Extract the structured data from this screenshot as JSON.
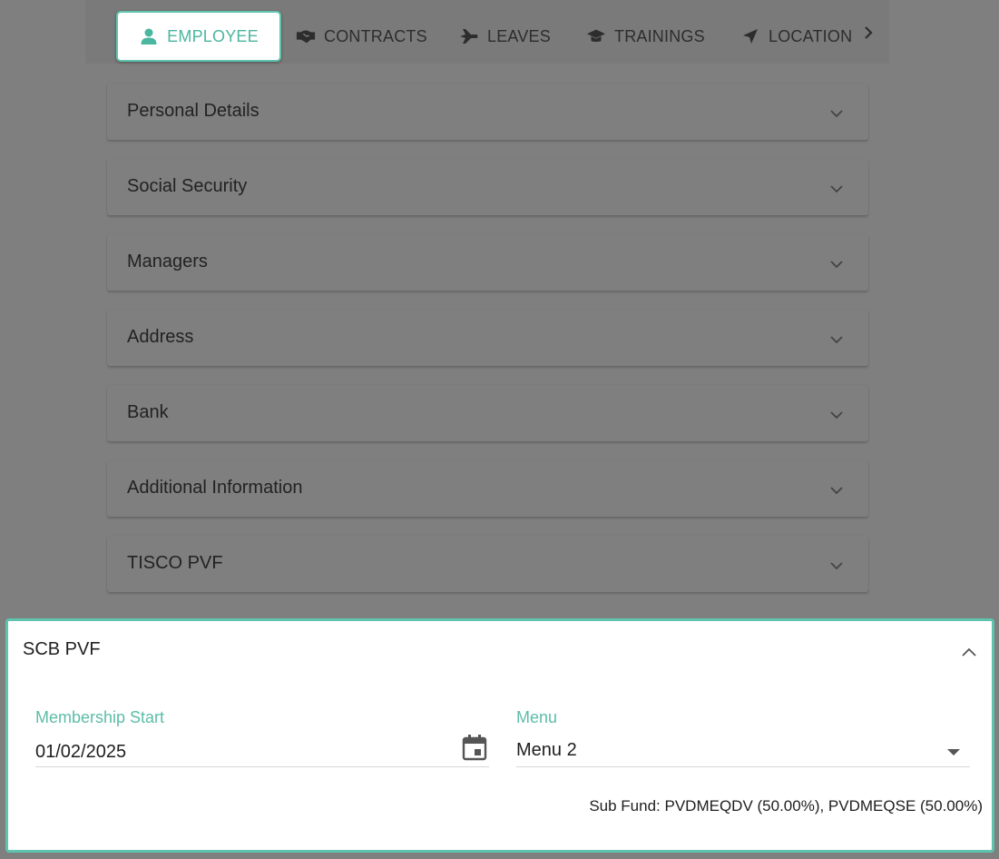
{
  "tabs": [
    {
      "label": "EMPLOYEE",
      "icon": "person-icon",
      "active": true
    },
    {
      "label": "CONTRACTS",
      "icon": "handshake-icon"
    },
    {
      "label": "LEAVES",
      "icon": "plane-icon"
    },
    {
      "label": "TRAININGS",
      "icon": "graduation-cap-icon"
    },
    {
      "label": "LOCATION",
      "icon": "location-arrow-icon"
    }
  ],
  "panels": [
    {
      "title": "Personal Details"
    },
    {
      "title": "Social Security"
    },
    {
      "title": "Managers"
    },
    {
      "title": "Address"
    },
    {
      "title": "Bank"
    },
    {
      "title": "Additional Information"
    },
    {
      "title": "TISCO PVF"
    }
  ],
  "scb": {
    "title": "SCB PVF",
    "membership_label": "Membership Start",
    "membership_value": "01/02/2025",
    "menu_label": "Menu",
    "menu_value": "Menu 2",
    "sub_fund": "Sub Fund: PVDMEQDV (50.00%), PVDMEQSE (50.00%)"
  },
  "colors": {
    "accent": "#5fc3ad",
    "overlay": "#7f7f7f"
  }
}
